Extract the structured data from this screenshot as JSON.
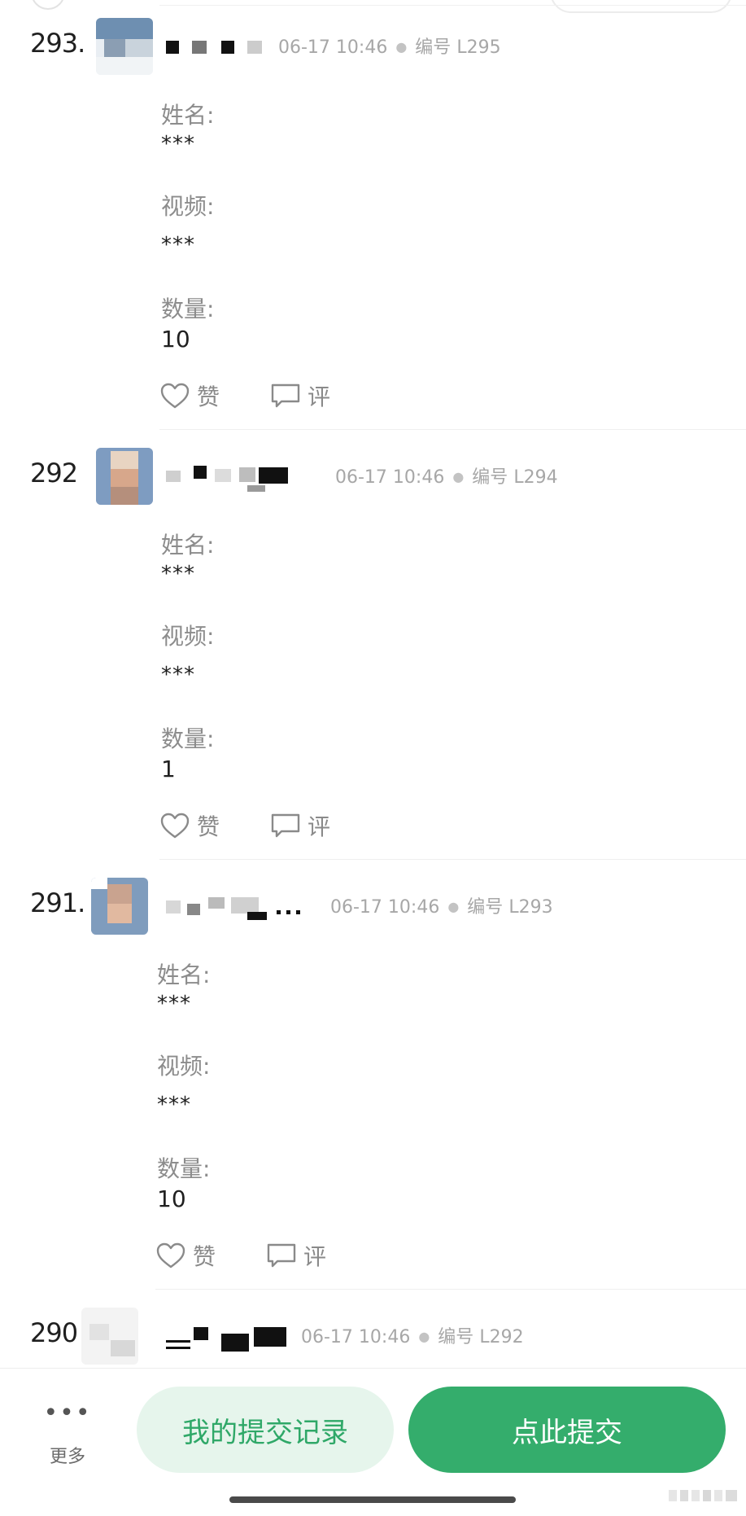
{
  "entries": [
    {
      "index": "293.",
      "timestamp": "06-17 10:46",
      "serial_label": "编号",
      "serial": "L295",
      "fields": [
        {
          "label": "姓名:",
          "value": "***"
        },
        {
          "label": "视频:",
          "value": "***"
        },
        {
          "label": "数量:",
          "value": "10"
        }
      ],
      "like_label": "赞",
      "comment_label": "评"
    },
    {
      "index": "292",
      "timestamp": "06-17 10:46",
      "serial_label": "编号",
      "serial": "L294",
      "fields": [
        {
          "label": "姓名:",
          "value": "***"
        },
        {
          "label": "视频:",
          "value": "***"
        },
        {
          "label": "数量:",
          "value": "1"
        }
      ],
      "like_label": "赞",
      "comment_label": "评"
    },
    {
      "index": "291.",
      "timestamp": "06-17 10:46",
      "serial_label": "编号",
      "serial": "L293",
      "fields": [
        {
          "label": "姓名:",
          "value": "***"
        },
        {
          "label": "视频:",
          "value": "***"
        },
        {
          "label": "数量:",
          "value": "10"
        }
      ],
      "like_label": "赞",
      "comment_label": "评"
    },
    {
      "index": "290",
      "timestamp": "06-17 10:46",
      "serial_label": "编号",
      "serial": "L292"
    }
  ],
  "bottom_bar": {
    "more_label": "更多",
    "records_button": "我的提交记录",
    "submit_button": "点此提交"
  },
  "colors": {
    "accent": "#34ad6c",
    "accent_light": "#e6f5ec"
  },
  "icons": {
    "like": "heart-outline-icon",
    "comment": "speech-bubble-icon",
    "more": "ellipsis-icon"
  }
}
